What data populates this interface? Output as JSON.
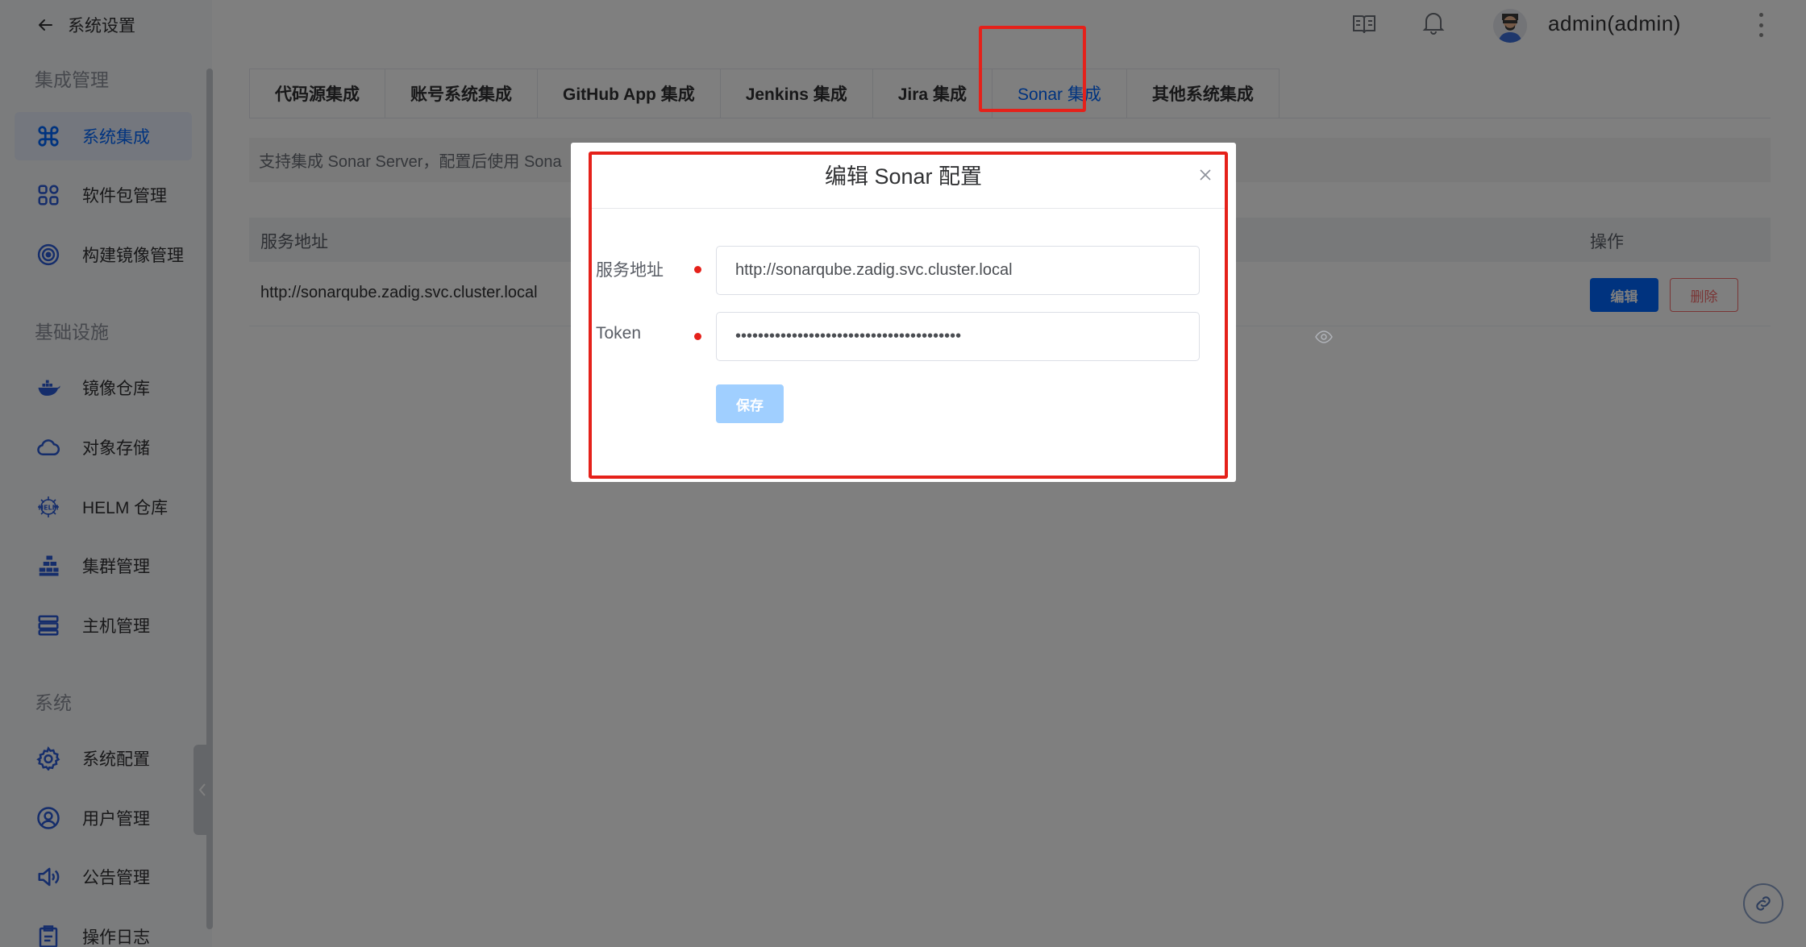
{
  "sidebar": {
    "back_title": "系统设置",
    "groups": [
      {
        "title": "集成管理",
        "items": [
          {
            "label": "系统集成",
            "icon": "command-icon",
            "active": true
          },
          {
            "label": "软件包管理",
            "icon": "grid-icon"
          },
          {
            "label": "构建镜像管理",
            "icon": "target-icon"
          }
        ]
      },
      {
        "title": "基础设施",
        "items": [
          {
            "label": "镜像仓库",
            "icon": "docker-icon"
          },
          {
            "label": "对象存储",
            "icon": "cloud-icon"
          },
          {
            "label": "HELM 仓库",
            "icon": "helm-icon"
          },
          {
            "label": "集群管理",
            "icon": "cluster-icon"
          },
          {
            "label": "主机管理",
            "icon": "server-icon"
          }
        ]
      },
      {
        "title": "系统",
        "items": [
          {
            "label": "系统配置",
            "icon": "settings-icon"
          },
          {
            "label": "用户管理",
            "icon": "user-icon"
          },
          {
            "label": "公告管理",
            "icon": "speaker-icon"
          },
          {
            "label": "操作日志",
            "icon": "clipboard-icon"
          }
        ]
      }
    ]
  },
  "topbar": {
    "username": "admin(admin)"
  },
  "tabs": [
    {
      "label": "代码源集成"
    },
    {
      "label": "账号系统集成"
    },
    {
      "label": "GitHub App 集成"
    },
    {
      "label": "Jenkins 集成"
    },
    {
      "label": "Jira 集成"
    },
    {
      "label": "Sonar 集成",
      "active": true
    },
    {
      "label": "其他系统集成"
    }
  ],
  "notice": "支持集成 Sonar Server，配置后使用 Sona",
  "table": {
    "headers": {
      "address": "服务地址",
      "actions": "操作"
    },
    "rows": [
      {
        "address": "http://sonarqube.zadig.svc.cluster.local",
        "edit": "编辑",
        "delete": "删除"
      }
    ]
  },
  "dialog": {
    "title": "编辑 Sonar 配置",
    "address_label": "服务地址",
    "address_value": "http://sonarqube.zadig.svc.cluster.local",
    "token_label": "Token",
    "token_value": "••••••••••••••••••••••••••••••••••••••••",
    "save_label": "保存"
  },
  "colors": {
    "accent": "#0066ff",
    "highlight": "#e5211a",
    "danger": "#f56c6c"
  }
}
